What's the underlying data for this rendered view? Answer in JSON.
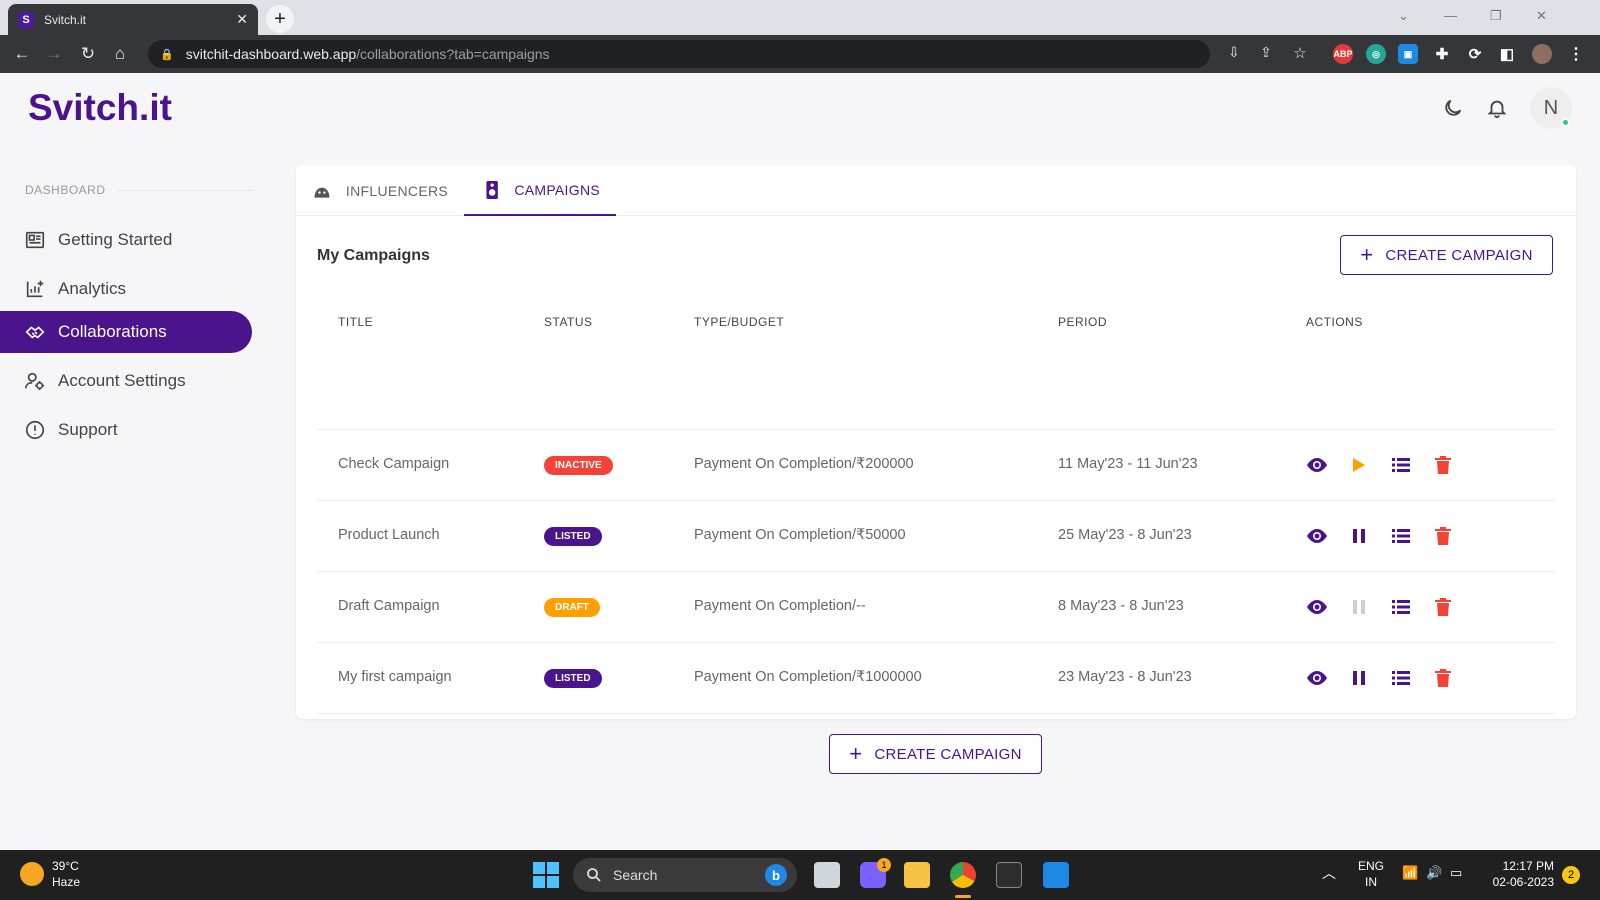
{
  "browser": {
    "tab_title": "Svitch.it",
    "tab_favicon": "S",
    "url_host": "svitchit-dashboard.web.app",
    "url_path": "/collaborations?tab=campaigns"
  },
  "header": {
    "logo": "Svitch.it",
    "avatar_initial": "N"
  },
  "sidebar": {
    "section_label": "DASHBOARD",
    "items": [
      {
        "label": "Getting Started",
        "icon": "newspaper-icon"
      },
      {
        "label": "Analytics",
        "icon": "analytics-icon"
      },
      {
        "label": "Collaborations",
        "icon": "handshake-icon",
        "active": true
      },
      {
        "label": "Account Settings",
        "icon": "user-settings-icon"
      },
      {
        "label": "Support",
        "icon": "alert-circle-icon"
      }
    ]
  },
  "tabs": [
    {
      "label": "INFLUENCERS",
      "icon": "influencer-icon"
    },
    {
      "label": "CAMPAIGNS",
      "icon": "speaker-icon",
      "active": true
    }
  ],
  "campaigns": {
    "title": "My Campaigns",
    "create_label": "CREATE CAMPAIGN",
    "columns": [
      "TITLE",
      "STATUS",
      "TYPE/BUDGET",
      "PERIOD",
      "ACTIONS"
    ],
    "rows": [
      {
        "title": "Check Campaign",
        "status": "INACTIVE",
        "status_color": "#f44336",
        "budget": "Payment On Completion/₹200000",
        "period": "11 May'23 - 11 Jun'23",
        "toggle": "play"
      },
      {
        "title": "Product Launch",
        "status": "LISTED",
        "status_color": "#4a148c",
        "budget": "Payment On Completion/₹50000",
        "period": "25 May'23 - 8 Jun'23",
        "toggle": "pause"
      },
      {
        "title": "Draft Campaign",
        "status": "DRAFT",
        "status_color": "#ffa000",
        "budget": "Payment On Completion/--",
        "period": "8 May'23 - 8 Jun'23",
        "toggle": "pause-disabled"
      },
      {
        "title": "My first campaign",
        "status": "LISTED",
        "status_color": "#4a148c",
        "budget": "Payment On Completion/₹1000000",
        "period": "23 May'23 - 8 Jun'23",
        "toggle": "pause"
      }
    ]
  },
  "taskbar": {
    "temp": "39°C",
    "weather": "Haze",
    "search": "Search",
    "lang1": "ENG",
    "lang2": "IN",
    "time": "12:17 PM",
    "date": "02-06-2023",
    "chat_badge": "1",
    "notif_count": "2"
  },
  "colors": {
    "accent": "#4a148c",
    "danger": "#f44336",
    "warning": "#ffa000"
  }
}
